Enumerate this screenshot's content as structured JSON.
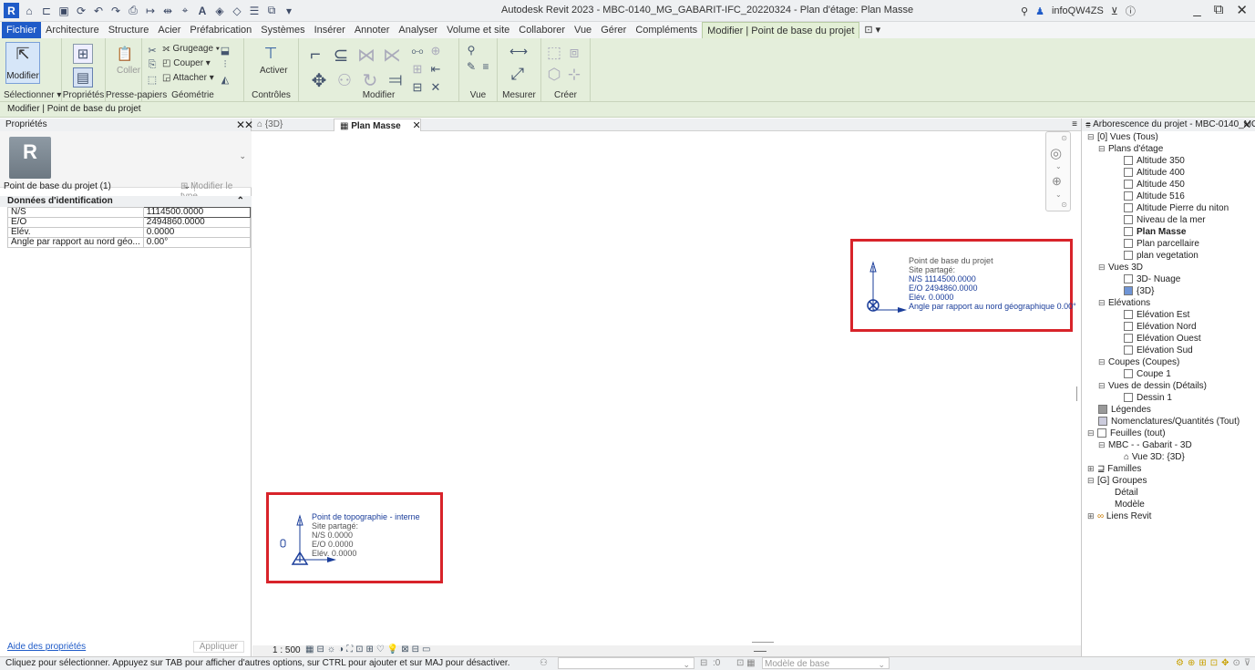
{
  "app": {
    "title": "Autodesk Revit 2023 - MBC-0140_MG_GABARIT-IFC_20220324 - Plan d'étage: Plan Masse",
    "user": "infoQW4ZS",
    "logo": "R"
  },
  "menu": {
    "tabs": [
      "Fichier",
      "Architecture",
      "Structure",
      "Acier",
      "Préfabrication",
      "Systèmes",
      "Insérer",
      "Annoter",
      "Analyser",
      "Volume et site",
      "Collaborer",
      "Vue",
      "Gérer",
      "Compléments",
      "Modifier | Point de base du projet"
    ],
    "active_index": 14
  },
  "ribbon": {
    "panels": {
      "select": "Sélectionner ▾",
      "properties": "Propriétés",
      "clipboard": "Presse-papiers",
      "geometry": "Géométrie",
      "controls": "Contrôles",
      "modify": "Modifier",
      "view": "Vue",
      "measure": "Mesurer",
      "create": "Créer"
    },
    "buttons": {
      "modify": "Modifier",
      "paste": "Coller",
      "cope": "Grugeage ▾",
      "cut": "Couper ▾",
      "join": "Attacher ▾",
      "activate": "Activer"
    }
  },
  "context_bar": "Modifier | Point de base du projet",
  "properties": {
    "title": "Propriétés",
    "selection": "Point de base du projet (1)",
    "edit_type": "Modifier le type",
    "group": "Données d'identification",
    "rows": [
      {
        "key": "N/S",
        "value": "1114500.0000"
      },
      {
        "key": "E/O",
        "value": "2494860.0000"
      },
      {
        "key": "Elév.",
        "value": "0.0000"
      },
      {
        "key": "Angle par rapport au nord géo...",
        "value": "0.00°"
      }
    ],
    "help": "Aide des propriétés",
    "apply": "Appliquer"
  },
  "view_tabs": {
    "tab1": "{3D}",
    "tab2": "Plan Masse"
  },
  "project_base_point": {
    "title": "Point de base du projet",
    "shared": "Site partagé:",
    "ns": "N/S  1114500.0000",
    "eo": "E/O  2494860.0000",
    "elev": "Elév.  0.0000",
    "angle": "Angle par rapport au nord géographique  0.00°"
  },
  "survey_point": {
    "title": "Point de topographie - interne",
    "shared": "Site partagé:",
    "ns": "N/S  0.0000",
    "eo": "E/O  0.0000",
    "elev": "Elév.  0.0000"
  },
  "view_control": {
    "scale": "1 : 500"
  },
  "browser": {
    "title": "Arborescence du projet - MBC-0140_MG_...",
    "nodes": [
      {
        "label": "Vues (Tous)"
      },
      {
        "label": "Plans d'étage"
      },
      {
        "label": "Altitude 350"
      },
      {
        "label": "Altitude 400"
      },
      {
        "label": "Altitude 450"
      },
      {
        "label": "Altitude 516"
      },
      {
        "label": "Altitude Pierre du niton"
      },
      {
        "label": "Niveau de la mer"
      },
      {
        "label": "Plan Masse"
      },
      {
        "label": "Plan parcellaire"
      },
      {
        "label": "plan vegetation"
      },
      {
        "label": "Vues 3D"
      },
      {
        "label": "3D- Nuage"
      },
      {
        "label": "{3D}"
      },
      {
        "label": "Elévations"
      },
      {
        "label": "Elévation Est"
      },
      {
        "label": "Elévation Nord"
      },
      {
        "label": "Elévation Ouest"
      },
      {
        "label": "Elévation Sud"
      },
      {
        "label": "Coupes (Coupes)"
      },
      {
        "label": "Coupe 1"
      },
      {
        "label": "Vues de dessin (Détails)"
      },
      {
        "label": "Dessin 1"
      },
      {
        "label": "Légendes"
      },
      {
        "label": "Nomenclatures/Quantités (Tout)"
      },
      {
        "label": "Feuilles (tout)"
      },
      {
        "label": "MBC - - Gabarit - 3D"
      },
      {
        "label": "Vue 3D: {3D}"
      },
      {
        "label": "Familles"
      },
      {
        "label": "Groupes"
      },
      {
        "label": "Détail"
      },
      {
        "label": "Modèle"
      },
      {
        "label": "Liens Revit"
      }
    ]
  },
  "status": {
    "hint": "Cliquez pour sélectionner. Appuyez sur TAB pour afficher d'autres options, sur CTRL pour ajouter et sur MAJ pour désactiver.",
    "zero": ":0",
    "model": "Modèle de base"
  },
  "colors": {
    "accent": "#1f5bc8",
    "ribbon": "#e4eedb",
    "highlight": "#d8232a",
    "point_blue": "#1a3d9a"
  }
}
